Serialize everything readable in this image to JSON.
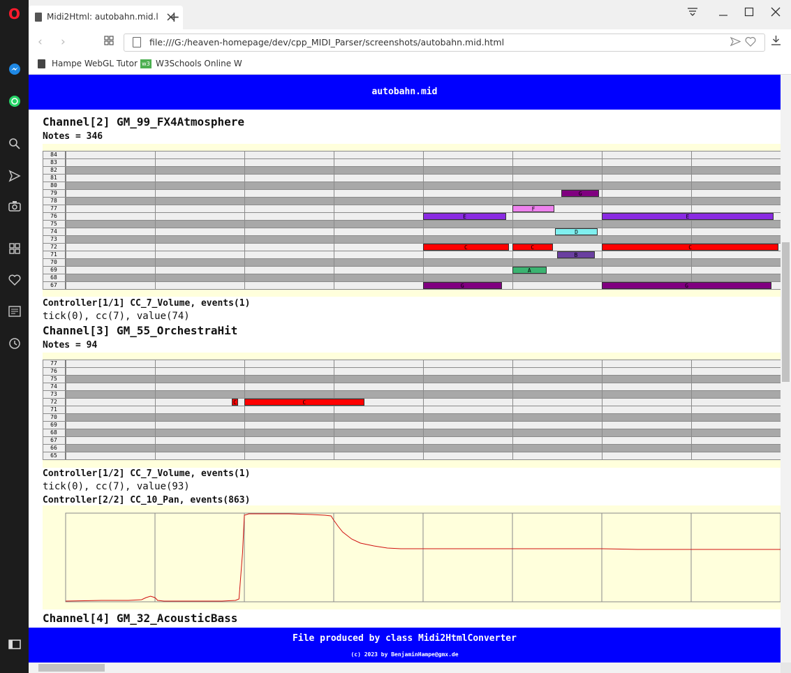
{
  "browser": {
    "tab_title": "Midi2Html: autobahn.mid.l",
    "url": "file:///G:/heaven-homepage/dev/cpp_MIDI_Parser/screenshots/autobahn.mid.html",
    "bookmarks": [
      {
        "label": "Hampe WebGL Tutor"
      },
      {
        "label": "W3Schools Online W"
      }
    ],
    "w3_badge": "w3"
  },
  "page": {
    "title": "autobahn.mid",
    "footer_line1": "File produced by class Midi2HtmlConverter",
    "footer_line2": "(c) 2023 by BenjaminHampe@gmx.de"
  },
  "channels": [
    {
      "heading": "Channel[2] GM_99_FX4Atmosphere",
      "notes": "Notes = 346",
      "pitches": [
        84,
        83,
        82,
        81,
        80,
        79,
        78,
        77,
        76,
        75,
        74,
        73,
        72,
        71,
        70,
        69,
        68,
        67
      ],
      "dark_rows": [
        82,
        80,
        78,
        75,
        73,
        70,
        68
      ],
      "notes_list": [
        {
          "pitch": 79,
          "start_beat": 5.55,
          "end_beat": 5.97,
          "label": "G",
          "color": "#800080"
        },
        {
          "pitch": 77,
          "start_beat": 5.0,
          "end_beat": 5.47,
          "label": "F",
          "color": "#ee82ee"
        },
        {
          "pitch": 76,
          "start_beat": 4.0,
          "end_beat": 4.93,
          "label": "E",
          "color": "#8a2be2"
        },
        {
          "pitch": 76,
          "start_beat": 6.0,
          "end_beat": 7.92,
          "label": "E",
          "color": "#8a2be2"
        },
        {
          "pitch": 74,
          "start_beat": 5.48,
          "end_beat": 5.95,
          "label": "D",
          "color": "#7fefef"
        },
        {
          "pitch": 72,
          "start_beat": 4.0,
          "end_beat": 4.96,
          "label": "C",
          "color": "#ff0000"
        },
        {
          "pitch": 72,
          "start_beat": 5.0,
          "end_beat": 5.45,
          "label": "C",
          "color": "#ff0000"
        },
        {
          "pitch": 72,
          "start_beat": 6.0,
          "end_beat": 7.98,
          "label": "C",
          "color": "#ff0000"
        },
        {
          "pitch": 71,
          "start_beat": 5.5,
          "end_beat": 5.92,
          "label": "B",
          "color": "#6a3fa0"
        },
        {
          "pitch": 69,
          "start_beat": 5.0,
          "end_beat": 5.38,
          "label": "A",
          "color": "#3cb371"
        },
        {
          "pitch": 67,
          "start_beat": 4.0,
          "end_beat": 4.88,
          "label": "G",
          "color": "#800080"
        },
        {
          "pitch": 67,
          "start_beat": 6.0,
          "end_beat": 7.9,
          "label": "G",
          "color": "#800080"
        }
      ],
      "controllers": [
        {
          "title": "Controller[1/1] CC_7_Volume, events(1)",
          "events": "tick(0), cc(7), value(74)"
        }
      ]
    },
    {
      "heading": "Channel[3] GM_55_OrchestraHit",
      "notes": "Notes = 94",
      "pitches": [
        77,
        76,
        75,
        74,
        73,
        72,
        71,
        70,
        69,
        68,
        67,
        66,
        65
      ],
      "dark_rows": [
        75,
        73,
        70,
        68,
        66
      ],
      "notes_list": [
        {
          "pitch": 72,
          "start_beat": 1.86,
          "end_beat": 1.93,
          "label": "C",
          "color": "#ff0000"
        },
        {
          "pitch": 72,
          "start_beat": 2.0,
          "end_beat": 3.34,
          "label": "C",
          "color": "#ff0000"
        }
      ],
      "controllers": [
        {
          "title": "Controller[1/2] CC_7_Volume, events(1)",
          "events": "tick(0), cc(7), value(93)"
        },
        {
          "title": "Controller[2/2] CC_10_Pan, events(863)",
          "events": ""
        }
      ]
    },
    {
      "heading": "Channel[4] GM_32_AcousticBass"
    }
  ],
  "chart_data": {
    "type": "line",
    "title": "",
    "xlabel": "",
    "ylabel": "",
    "ylim": [
      0,
      127
    ],
    "xlim": [
      0,
      8
    ],
    "series": [
      {
        "values_xy": [
          [
            0.0,
            1
          ],
          [
            0.4,
            2
          ],
          [
            0.7,
            2
          ],
          [
            0.85,
            3
          ],
          [
            0.9,
            6
          ],
          [
            0.95,
            8
          ],
          [
            1.0,
            6
          ],
          [
            1.03,
            2
          ],
          [
            1.1,
            1
          ],
          [
            1.5,
            1
          ],
          [
            1.75,
            1
          ],
          [
            1.9,
            2
          ],
          [
            1.94,
            4
          ],
          [
            1.98,
            70
          ],
          [
            2.0,
            124
          ],
          [
            2.05,
            126
          ],
          [
            2.2,
            126
          ],
          [
            2.5,
            126
          ],
          [
            2.75,
            125
          ],
          [
            2.9,
            124
          ],
          [
            2.97,
            123
          ],
          [
            3.0,
            117
          ],
          [
            3.05,
            108
          ],
          [
            3.1,
            100
          ],
          [
            3.2,
            90
          ],
          [
            3.3,
            84
          ],
          [
            3.45,
            80
          ],
          [
            3.6,
            77
          ],
          [
            3.75,
            76
          ],
          [
            4.0,
            76
          ],
          [
            5.0,
            76
          ],
          [
            6.0,
            76
          ],
          [
            6.4,
            75
          ],
          [
            7.0,
            75
          ],
          [
            8.0,
            75
          ]
        ]
      }
    ]
  }
}
